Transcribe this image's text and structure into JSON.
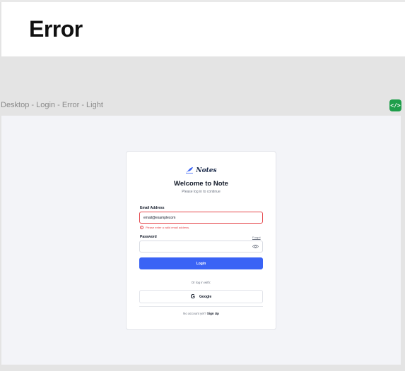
{
  "header": {
    "title": "Error"
  },
  "frame": {
    "label": "Desktop - Login - Error - Light",
    "code_button": "</>"
  },
  "card": {
    "brand": "Notes",
    "welcome": "Welcome to Note",
    "subtitle": "Please log in to continue",
    "email": {
      "label": "Email Address",
      "value": "email@examplecom",
      "error": "Please enter a valid email address."
    },
    "password": {
      "label": "Password",
      "forgot": "Forgot",
      "value": ""
    },
    "login_button": "Login",
    "or_text": "Or log in with:",
    "google_icon_glyph": "G",
    "google_button": "Google",
    "no_account": "No account yet?",
    "signup": "Sign Up"
  },
  "colors": {
    "accent": "#3a63f5",
    "error": "#e5484d",
    "code_button": "#1e9e4a"
  },
  "icons": [
    "feather-logo-icon",
    "error-circle-icon",
    "eye-icon",
    "google-icon",
    "code-icon"
  ]
}
